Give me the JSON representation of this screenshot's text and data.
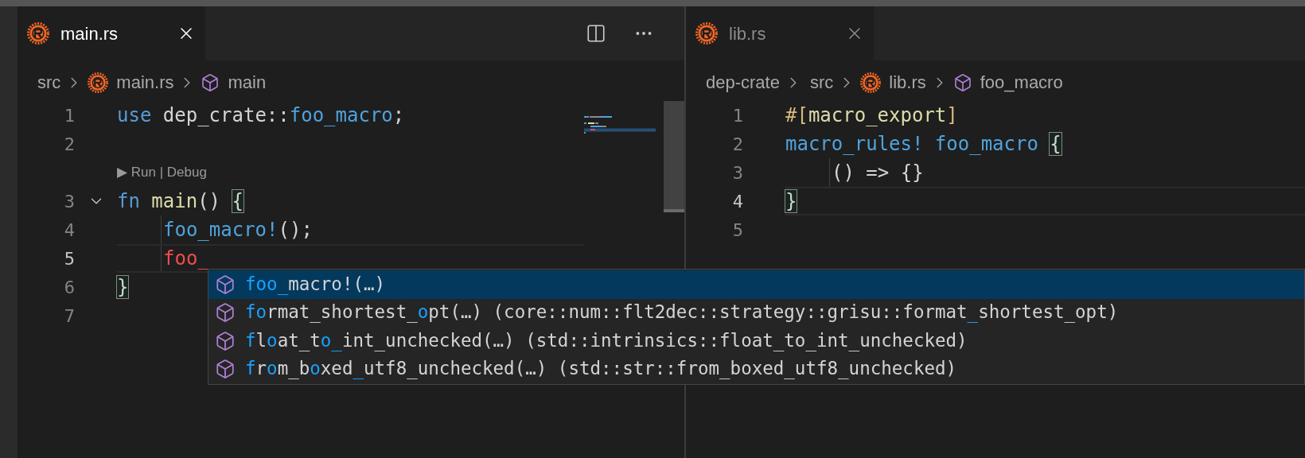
{
  "editor_groups": [
    {
      "focused": true,
      "tab": {
        "label": "main.rs",
        "selected": true
      },
      "breadcrumbs": [
        {
          "label": "src",
          "kind": "folder"
        },
        {
          "label": "main.rs",
          "kind": "file"
        },
        {
          "label": "main",
          "kind": "symbol"
        }
      ],
      "lines": [
        {
          "kind": "code",
          "number": "1",
          "current": false,
          "tokens": [
            {
              "text": "use",
              "kind": "keyword"
            },
            {
              "text": " dep_crate::",
              "kind": "plain"
            },
            {
              "text": "foo_macro",
              "kind": "macro"
            },
            {
              "text": ";",
              "kind": "plain"
            }
          ]
        },
        {
          "kind": "code",
          "number": "2",
          "current": false
        },
        {
          "kind": "codelens",
          "text": "▶ Run | Debug"
        },
        {
          "kind": "code",
          "number": "3",
          "current": false,
          "expanded": true,
          "tokens": [
            {
              "text": "fn ",
              "kind": "keyword"
            },
            {
              "text": "main",
              "kind": "function"
            },
            {
              "text": "() ",
              "kind": "plain"
            },
            {
              "text": "{",
              "kind": "bracket_match"
            }
          ]
        },
        {
          "kind": "code",
          "number": "4",
          "current": false,
          "indent": true,
          "tokens": [
            {
              "text": "foo_macro!",
              "kind": "macro"
            },
            {
              "text": "();",
              "kind": "plain"
            }
          ]
        },
        {
          "kind": "code",
          "number": "5",
          "current": true,
          "indent": true,
          "tokens": [
            {
              "text": "foo_",
              "kind": "error"
            }
          ]
        },
        {
          "kind": "code",
          "number": "6",
          "current": false,
          "tokens": [
            {
              "text": "}",
              "kind": "bracket_match"
            }
          ]
        },
        {
          "kind": "code",
          "number": "7",
          "current": false
        }
      ]
    },
    {
      "focused": false,
      "tab": {
        "label": "lib.rs",
        "selected": true
      },
      "breadcrumbs": [
        {
          "label": "dep-crate",
          "kind": "folder"
        },
        {
          "label": "src",
          "kind": "folder"
        },
        {
          "label": "lib.rs",
          "kind": "file"
        },
        {
          "label": "foo_macro",
          "kind": "symbol"
        }
      ],
      "lines": [
        {
          "kind": "code",
          "number": "1",
          "current": false,
          "tokens": [
            {
              "text": "#[",
              "kind": "attribute"
            },
            {
              "text": "macro_export",
              "kind": "function"
            },
            {
              "text": "]",
              "kind": "attribute"
            }
          ]
        },
        {
          "kind": "code",
          "number": "2",
          "current": false,
          "tokens": [
            {
              "text": "macro_rules! foo_macro ",
              "kind": "macro"
            },
            {
              "text": "{",
              "kind": "bracket_match"
            }
          ]
        },
        {
          "kind": "code",
          "number": "3",
          "current": false,
          "indent": true,
          "tokens": [
            {
              "text": "() => {}",
              "kind": "plain"
            }
          ]
        },
        {
          "kind": "code",
          "number": "4",
          "current": true,
          "tokens": [
            {
              "text": "}",
              "kind": "bracket_match"
            }
          ]
        },
        {
          "kind": "code",
          "number": "5",
          "current": false
        }
      ]
    }
  ],
  "suggestions": [
    {
      "selected": true,
      "label": [
        {
          "text": "foo_",
          "match": true
        },
        {
          "text": "macro!(…)",
          "match": false
        }
      ]
    },
    {
      "selected": false,
      "label": [
        {
          "text": "fo",
          "match": true
        },
        {
          "text": "rmat_shortest_",
          "match": false
        },
        {
          "text": "o",
          "match": true
        },
        {
          "text": "pt(…)",
          "match": false
        }
      ],
      "detail": [
        {
          "text": "(core::num::flt2dec::strategy::grisu::format",
          "match": false
        },
        {
          "text": "_",
          "match": true
        },
        {
          "text": "shortest_opt)",
          "match": false
        }
      ]
    },
    {
      "selected": false,
      "label": [
        {
          "text": "f",
          "match": true
        },
        {
          "text": "l",
          "match": false
        },
        {
          "text": "o",
          "match": true
        },
        {
          "text": "at_t",
          "match": false
        },
        {
          "text": "o_",
          "match": true
        },
        {
          "text": "int_unchecked(…)",
          "match": false
        }
      ],
      "detail": [
        {
          "text": "(std::intrinsics::float_to_int_unchecked)",
          "match": false
        }
      ]
    },
    {
      "selected": false,
      "label": [
        {
          "text": "f",
          "match": true
        },
        {
          "text": "r",
          "match": false
        },
        {
          "text": "o",
          "match": true
        },
        {
          "text": "m_b",
          "match": false
        },
        {
          "text": "o",
          "match": true
        },
        {
          "text": "xed",
          "match": false
        },
        {
          "text": "_",
          "match": true
        },
        {
          "text": "utf8_unchecked(…)",
          "match": false
        }
      ],
      "detail": [
        {
          "text": "(std::str::from_boxed_utf8_unchecked)",
          "match": false
        }
      ]
    }
  ]
}
